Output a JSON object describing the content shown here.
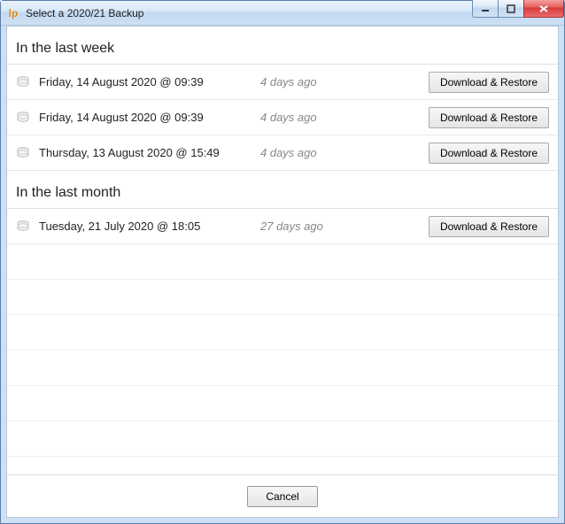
{
  "window": {
    "title": "Select a 2020/21 Backup"
  },
  "sections": {
    "week": {
      "header": "In the last week",
      "items": [
        {
          "label": "Friday, 14 August 2020 @ 09:39",
          "ago": "4 days ago",
          "action": "Download & Restore"
        },
        {
          "label": "Friday, 14 August 2020 @ 09:39",
          "ago": "4 days ago",
          "action": "Download & Restore"
        },
        {
          "label": "Thursday, 13 August 2020 @ 15:49",
          "ago": "4 days ago",
          "action": "Download & Restore"
        }
      ]
    },
    "month": {
      "header": "In the last month",
      "items": [
        {
          "label": "Tuesday, 21 July 2020 @ 18:05",
          "ago": "27 days ago",
          "action": "Download & Restore"
        }
      ]
    }
  },
  "footer": {
    "cancel": "Cancel"
  }
}
